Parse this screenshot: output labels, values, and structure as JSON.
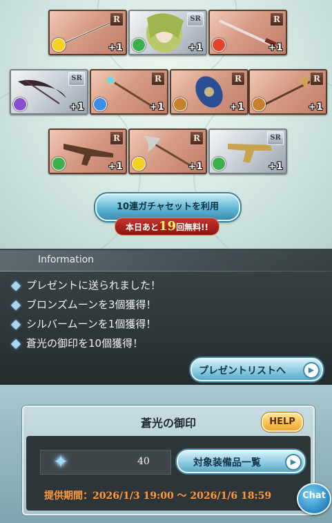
{
  "items": [
    {
      "rank": "R",
      "element": "light",
      "plus": "+1",
      "color": "#f4d21f"
    },
    {
      "rank": "SR",
      "element": "wind",
      "plus": "+1",
      "color": "#3cb04a"
    },
    {
      "rank": "R",
      "element": "fire",
      "plus": "+1",
      "color": "#e0452b"
    },
    {
      "rank": "SR",
      "element": "dark",
      "plus": "+1",
      "color": "#8a4fd1"
    },
    {
      "rank": "R",
      "element": "water",
      "plus": "+1",
      "color": "#3b8fe8"
    },
    {
      "rank": "R",
      "element": "earth",
      "plus": "+1",
      "color": "#c8812a"
    },
    {
      "rank": "R",
      "element": "earth",
      "plus": "+1",
      "color": "#c8812a"
    },
    {
      "rank": "R",
      "element": "wind",
      "plus": "+1",
      "color": "#3cb04a"
    },
    {
      "rank": "R",
      "element": "light",
      "plus": "+1",
      "color": "#f4d21f"
    },
    {
      "rank": "SR",
      "element": "wind",
      "plus": "+1",
      "color": "#3cb04a"
    }
  ],
  "gacha": {
    "button_label": "10連ガチャセットを利用",
    "free_prefix": "本日あと",
    "free_count": "19",
    "free_suffix": "回無料!!"
  },
  "info": {
    "title": "Information",
    "messages": [
      "プレゼントに送られました！",
      "ブロンズムーンを3個獲得！",
      "シルバームーンを1個獲得！",
      "蒼光の御印を10個獲得！"
    ],
    "present_list_label": "プレゼントリストへ"
  },
  "panel": {
    "title": "蒼光の御印",
    "help_label": "HELP",
    "count": "40",
    "equip_list_label": "対象装備品一覧",
    "period": "提供期間：2026/1/3 19:00 〜 2026/1/6 18:59"
  },
  "chat_label": "Chat"
}
